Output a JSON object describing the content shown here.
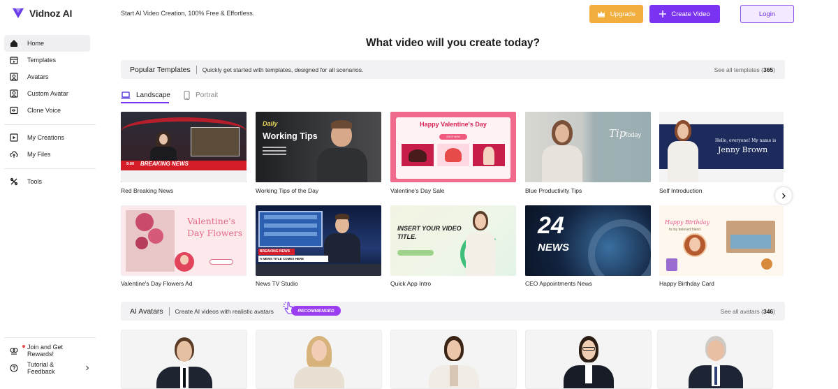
{
  "app": {
    "name": "Vidnoz AI",
    "tagline": "Start AI Video Creation, 100% Free & Effortless."
  },
  "header": {
    "upgrade_label": "Upgrade",
    "create_label": "Create Video",
    "login_label": "Login"
  },
  "sidebar": {
    "items": [
      {
        "label": "Home",
        "icon": "home-icon"
      },
      {
        "label": "Templates",
        "icon": "templates-icon"
      },
      {
        "label": "Avatars",
        "icon": "avatar-icon"
      },
      {
        "label": "Custom Avatar",
        "icon": "custom-avatar-icon"
      },
      {
        "label": "Clone Voice",
        "icon": "voice-icon"
      },
      {
        "label": "My Creations",
        "icon": "creations-icon"
      },
      {
        "label": "My Files",
        "icon": "upload-icon"
      },
      {
        "label": "Tools",
        "icon": "tools-icon"
      }
    ],
    "bottom": [
      {
        "label": "Join and Get Rewards!",
        "icon": "rewards-icon"
      },
      {
        "label": "Tutorial & Feedback",
        "icon": "help-icon"
      }
    ]
  },
  "main": {
    "heading": "What video will you create today?",
    "templates_section": {
      "title": "Popular Templates",
      "subtitle": "Quickly get started with templates, designed for all scenarios.",
      "see_all": "See all templates (",
      "count": "365",
      "see_all_end": ")"
    },
    "tabs": [
      {
        "label": "Landscape",
        "active": true
      },
      {
        "label": "Portrait",
        "active": false
      }
    ],
    "templates": [
      {
        "title": "Red Breaking News",
        "overlay": "BREAKING NEWS",
        "overlay2": "9:00"
      },
      {
        "title": "Working Tips of the Day",
        "overlay": "Working Tips",
        "overlay2": "Daily"
      },
      {
        "title": "Valentine's Day Sale",
        "overlay": "Happy Valentine's Day",
        "overlay2": "SHOP NOW"
      },
      {
        "title": "Blue Productivity Tips",
        "overlay": "Tip",
        "overlay2": "Today"
      },
      {
        "title": "Self Introduction",
        "overlay": "Jenny Brown",
        "overlay2": "Hello, everyone! My name is"
      },
      {
        "title": "Valentine's Day Flowers Ad",
        "overlay": "Valentine's",
        "overlay2": "Day Flowers"
      },
      {
        "title": "News TV Studio",
        "overlay": "BREAKING NEWS",
        "overlay2": "A NEWS TITLE COMES HERE"
      },
      {
        "title": "Quick App Intro",
        "overlay": "INSERT YOUR VIDEO",
        "overlay2": "TITLE."
      },
      {
        "title": "CEO Appointments News",
        "overlay": "24",
        "overlay2": "NEWS"
      },
      {
        "title": "Happy Birthday Card",
        "overlay": "Happy Birthday",
        "overlay2": "to my beloved friend"
      }
    ],
    "avatars_section": {
      "title": "AI Avatars",
      "subtitle": "Create AI videos with realistic avatars",
      "badge": "RECOMMENDED",
      "see_all": "See all avatars (",
      "count": "346",
      "see_all_end": ")"
    }
  },
  "colors": {
    "accent": "#7b33f2",
    "upgrade": "#f2ae3d",
    "recommended": "#9a3cf0"
  }
}
